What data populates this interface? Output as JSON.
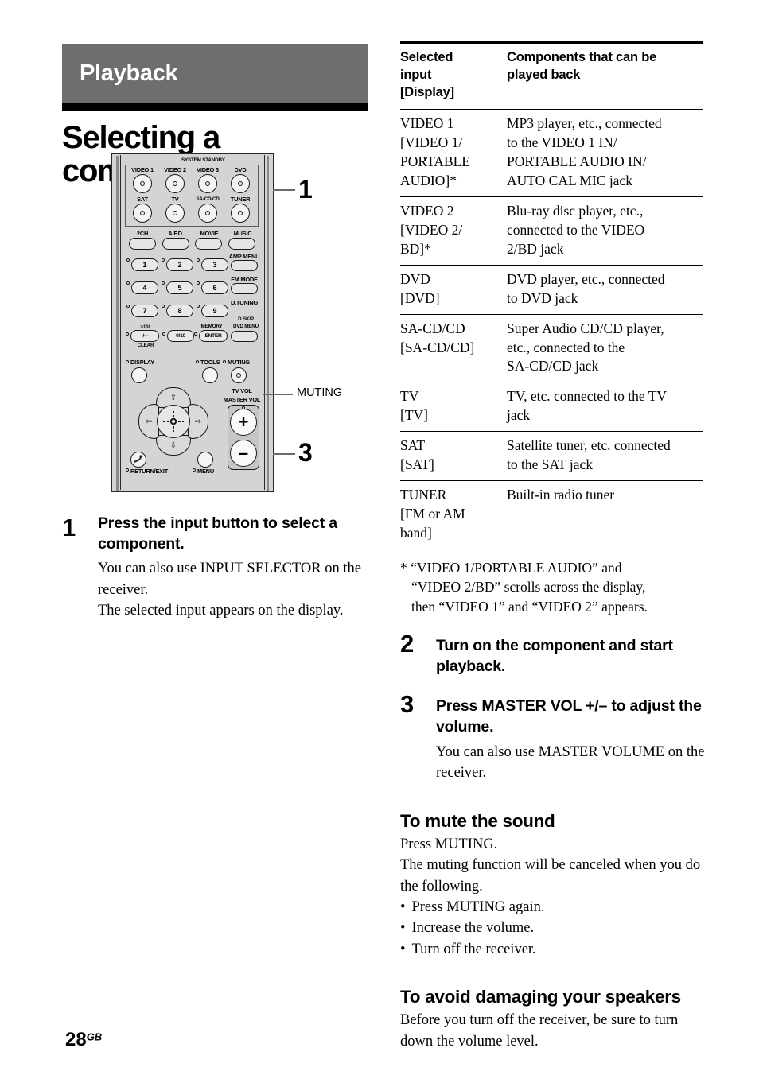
{
  "section": {
    "banner_title": "Playback",
    "page_title": "Selecting a component"
  },
  "remote": {
    "system_standby_label": "SYSTEM STANDBY",
    "input_buttons_row1": [
      "VIDEO 1",
      "VIDEO 2",
      "VIDEO 3",
      "DVD"
    ],
    "input_buttons_row2": [
      "SAT",
      "TV",
      "SA-CD/CD",
      "TUNER"
    ],
    "mode_buttons": [
      "2CH",
      "A.F.D.",
      "MOVIE",
      "MUSIC"
    ],
    "numeric_row1": [
      "1",
      "2",
      "3"
    ],
    "numeric_row2": [
      "4",
      "5",
      "6"
    ],
    "numeric_row3": [
      "7",
      "8",
      "9"
    ],
    "side_buttons": [
      "AMP MENU",
      "FM MODE",
      "D.TUNING"
    ],
    "num_row4": {
      "clear_top": ">10/.",
      "clear_mid": "-/- -",
      "clear_bottom": "CLEAR",
      "zero": "0/10",
      "memory_label": "MEMORY",
      "enter": "ENTER",
      "dskip_label": "D.SKIP",
      "dvdmenu_label": "DVD MENU"
    },
    "display_label": "DISPLAY",
    "tools_label": "TOOLS",
    "muting_label": "MUTING",
    "tv_vol_label": "TV VOL",
    "master_vol_label": "MASTER VOL",
    "vol_plus": "+",
    "vol_minus": "–",
    "return_exit_label": "RETURN/EXIT",
    "menu_label": "MENU"
  },
  "callouts": {
    "one": "1",
    "three": "3",
    "muting": "MUTING"
  },
  "steps_left": [
    {
      "num": "1",
      "heading": "Press the input button to select a component.",
      "body": [
        "You can also use INPUT SELECTOR on the receiver.",
        "The selected input appears on the display."
      ]
    }
  ],
  "table": {
    "headers": [
      "Selected input [Display]",
      "Components that can be played back"
    ],
    "header_col1_lines": [
      "Selected",
      "input",
      "[Display]"
    ],
    "header_col2_lines": [
      "Components that can be",
      "played back"
    ],
    "rows": [
      {
        "input": "VIDEO 1 [VIDEO 1/ PORTABLE AUDIO]*",
        "input_lines": [
          "VIDEO 1",
          "[VIDEO 1/",
          "PORTABLE",
          "AUDIO]*"
        ],
        "components": "MP3 player, etc., connected to the VIDEO 1 IN/ PORTABLE AUDIO IN/ AUTO CAL MIC jack",
        "components_lines": [
          "MP3 player, etc., connected",
          "to the VIDEO 1 IN/",
          "PORTABLE AUDIO IN/",
          "AUTO CAL MIC jack"
        ]
      },
      {
        "input": "VIDEO 2 [VIDEO 2/ BD]*",
        "input_lines": [
          "VIDEO 2",
          "[VIDEO 2/",
          "BD]*"
        ],
        "components": "Blu-ray disc player, etc., connected to the VIDEO 2/BD jack",
        "components_lines": [
          "Blu-ray disc player, etc.,",
          "connected to the VIDEO",
          "2/BD jack"
        ]
      },
      {
        "input": "DVD [DVD]",
        "input_lines": [
          "DVD",
          "[DVD]"
        ],
        "components": "DVD player, etc., connected to DVD jack",
        "components_lines": [
          "DVD player, etc., connected",
          "to DVD jack"
        ]
      },
      {
        "input": "SA-CD/CD [SA-CD/CD]",
        "input_lines": [
          "SA-CD/CD",
          "[SA-CD/CD]"
        ],
        "components": "Super Audio CD/CD player, etc., connected to the SA-CD/CD jack",
        "components_lines": [
          "Super Audio CD/CD player,",
          "etc., connected to the",
          "SA-CD/CD jack"
        ]
      },
      {
        "input": "TV [TV]",
        "input_lines": [
          "TV",
          "[TV]"
        ],
        "components": "TV, etc. connected to the TV jack",
        "components_lines": [
          "TV, etc. connected to the TV",
          "jack"
        ]
      },
      {
        "input": "SAT [SAT]",
        "input_lines": [
          "SAT",
          "[SAT]"
        ],
        "components": "Satellite tuner, etc. connected to the SAT jack",
        "components_lines": [
          "Satellite tuner, etc. connected",
          "to the SAT jack"
        ]
      },
      {
        "input": "TUNER [FM or AM band]",
        "input_lines": [
          "TUNER",
          "[FM or AM",
          "band]"
        ],
        "components": "Built-in radio tuner",
        "components_lines": [
          "Built-in radio tuner"
        ]
      }
    ],
    "footnote_lines": [
      "* “VIDEO 1/PORTABLE AUDIO” and",
      "“VIDEO 2/BD” scrolls across the display,",
      "then “VIDEO 1” and “VIDEO 2” appears."
    ]
  },
  "steps_right": [
    {
      "num": "2",
      "heading": "Turn on the component and start playback.",
      "body": ""
    },
    {
      "num": "3",
      "heading": "Press MASTER VOL +/– to adjust the volume.",
      "body": "You can also use MASTER VOLUME on the receiver."
    }
  ],
  "mute_section": {
    "heading": "To mute the sound",
    "line1": "Press MUTING.",
    "line2": "The muting function will be canceled when you do the following.",
    "bullets": [
      "Press MUTING again.",
      "Increase the volume.",
      "Turn off the receiver."
    ]
  },
  "speakers_section": {
    "heading": "To avoid damaging your speakers",
    "body": "Before you turn off the receiver, be sure to turn down the volume level."
  },
  "footer": {
    "page_number": "28",
    "page_suffix": "GB"
  },
  "colors": {
    "banner_bg": "#6e6e6e",
    "banner_text": "#ffffff",
    "rule": "#000000",
    "remote_body": "#d4d4d4"
  }
}
